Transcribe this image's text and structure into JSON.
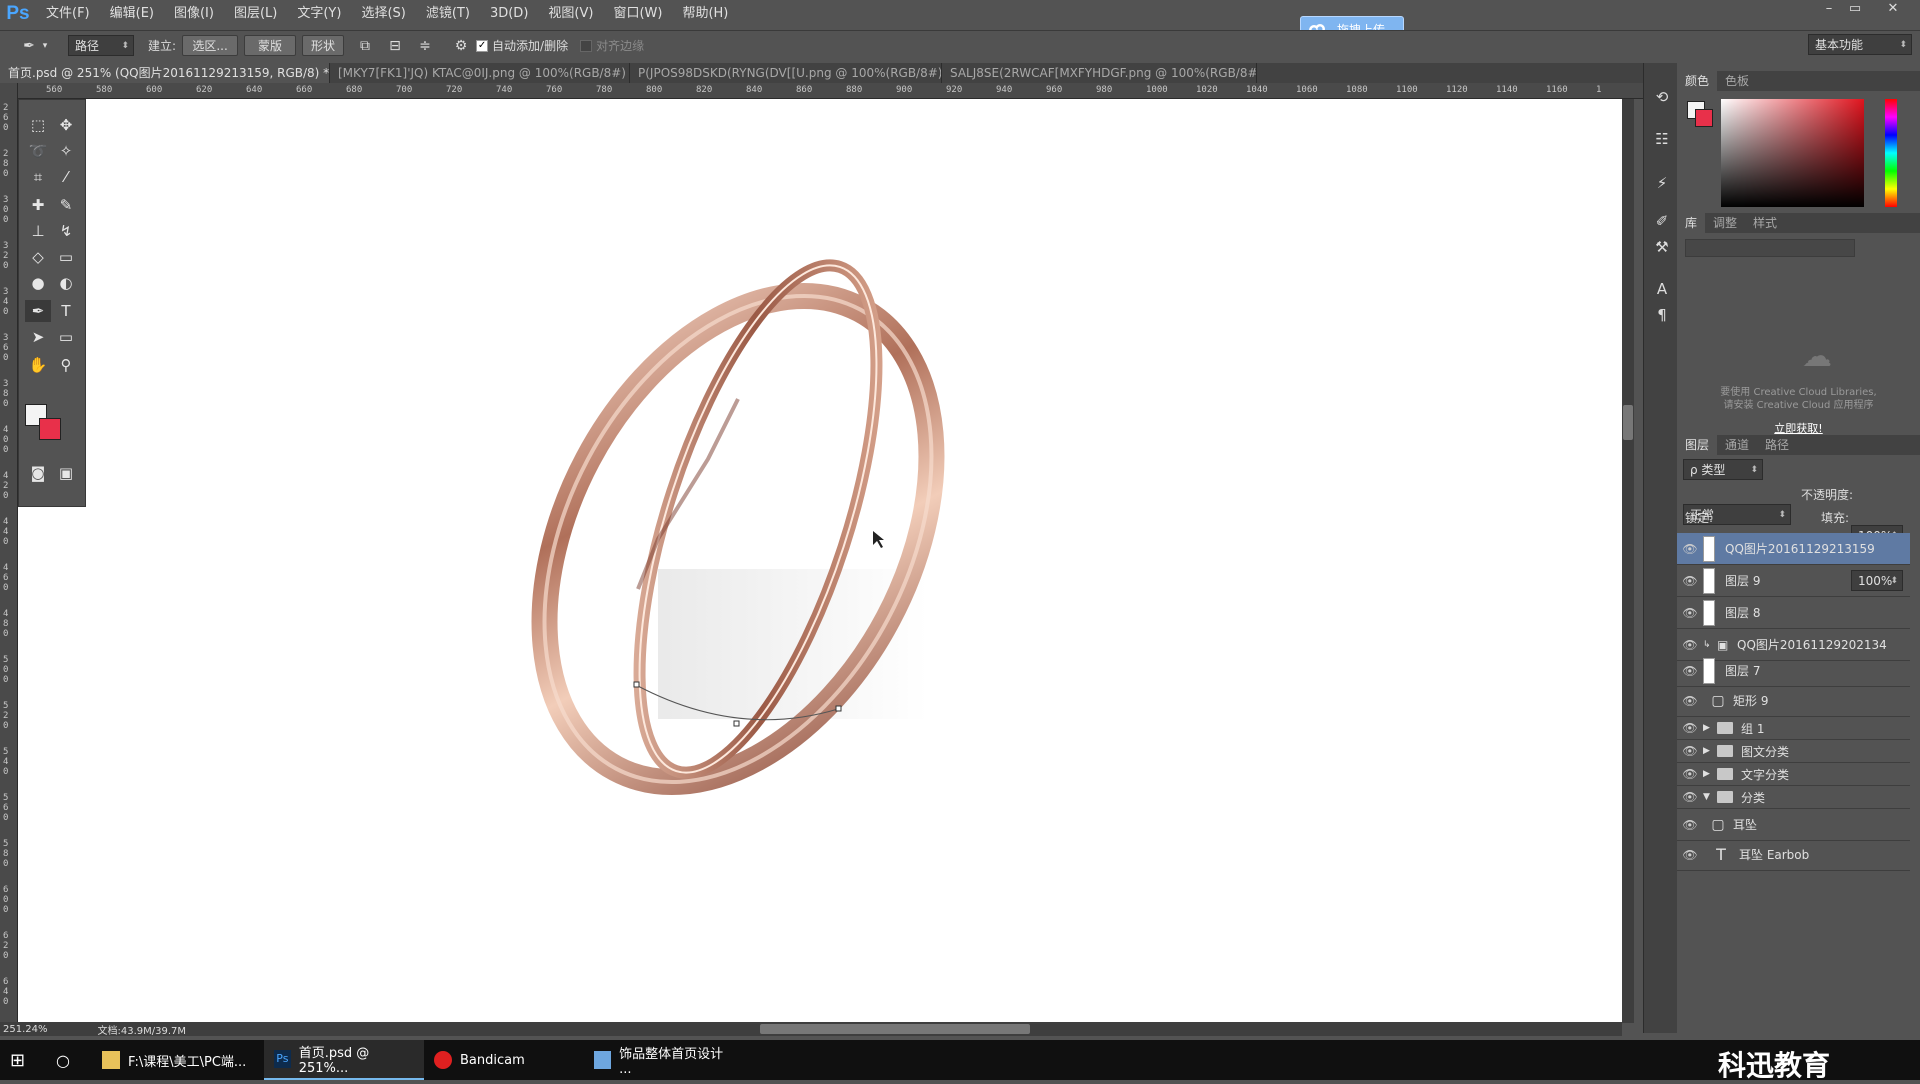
{
  "app": {
    "logo": "Ps"
  },
  "menubar": {
    "items": [
      "文件(F)",
      "编辑(E)",
      "图像(I)",
      "图层(L)",
      "文字(Y)",
      "选择(S)",
      "滤镜(T)",
      "3D(D)",
      "视图(V)",
      "窗口(W)",
      "帮助(H)"
    ],
    "cloud_upload": "拖拽上传",
    "window_buttons": [
      "–",
      "▭",
      "✕"
    ]
  },
  "options_bar": {
    "tool_icon": "pen-icon",
    "mode_select": "路径",
    "make_label": "建立:",
    "selection_button": "选区...",
    "mask_button": "蒙版",
    "shape_button": "形状",
    "auto_add_delete_label": "自动添加/删除",
    "auto_add_delete_checked": true,
    "align_edges_label": "对齐边缘",
    "align_edges_checked": false,
    "workspace_select": "基本功能"
  },
  "tabs": [
    {
      "label": "首页.psd @ 251% (QQ图片20161129213159, RGB/8) *",
      "active": true
    },
    {
      "label": "[MKY7[FK1]'JQ) KTAC@0IJ.png @ 100%(RGB/8#)",
      "active": false
    },
    {
      "label": "P(JPOS98DSKD(RYNG(DV[[U.png @ 100%(RGB/8#)",
      "active": false
    },
    {
      "label": "SALJ8SE(2RWCAF[MXFYHDGF.png @ 100%(RGB/8#)",
      "active": false
    }
  ],
  "ruler": {
    "h_ticks": [
      "560",
      "580",
      "600",
      "620",
      "640",
      "660",
      "680",
      "700",
      "720",
      "740",
      "760",
      "780",
      "800",
      "820",
      "840",
      "860",
      "880",
      "900",
      "920",
      "940",
      "960",
      "980",
      "1000",
      "1020",
      "1040",
      "1060",
      "1080",
      "1100",
      "1120",
      "1140",
      "1160",
      "1"
    ],
    "v_ticks": [
      "260",
      "280",
      "300",
      "320",
      "340",
      "360",
      "380",
      "400",
      "420",
      "440",
      "460",
      "480",
      "500",
      "520",
      "540",
      "560",
      "580",
      "600",
      "620",
      "640"
    ]
  },
  "status": {
    "zoom": "251.24%",
    "doc": "文档:43.9M/39.7M"
  },
  "color_panel": {
    "tabs": [
      "颜色",
      "色板"
    ],
    "fg": "#f4f4f4",
    "bg": "#e8304a"
  },
  "library_panel": {
    "tabs": [
      "库",
      "调整",
      "样式"
    ],
    "message_line1": "要使用 Creative Cloud Libraries,",
    "message_line2": "请安装 Creative Cloud 应用程序",
    "get_link": "立即获取!"
  },
  "layers_panel": {
    "tabs": [
      "图层",
      "通道",
      "路径"
    ],
    "filter_select": "ρ 类型",
    "blend_mode": "正常",
    "opacity_label": "不透明度:",
    "opacity_value": "100%",
    "lock_label": "锁定:",
    "fill_label": "填充:",
    "fill_value": "100%",
    "layers": [
      {
        "name": "QQ图片20161129213159",
        "selected": true,
        "kind": "image"
      },
      {
        "name": "图层 9",
        "selected": false,
        "kind": "image"
      },
      {
        "name": "图层 8",
        "selected": false,
        "kind": "image"
      },
      {
        "name": "QQ图片20161129202134",
        "selected": false,
        "kind": "smart"
      },
      {
        "name": "图层 7",
        "selected": false,
        "kind": "image"
      },
      {
        "name": "矩形 9",
        "selected": false,
        "kind": "shape"
      },
      {
        "name": "组 1",
        "selected": false,
        "kind": "group"
      },
      {
        "name": "图文分类",
        "selected": false,
        "kind": "group"
      },
      {
        "name": "文字分类",
        "selected": false,
        "kind": "group"
      },
      {
        "name": "分类",
        "selected": false,
        "kind": "group-open"
      },
      {
        "name": "耳坠",
        "selected": false,
        "kind": "shape"
      },
      {
        "name": "耳坠 Earbob",
        "selected": false,
        "kind": "text"
      }
    ]
  },
  "taskbar": {
    "items": [
      {
        "label": "F:\\课程\\美工\\PC端...",
        "icon": "folder-icon"
      },
      {
        "label": "首页.psd @ 251%...",
        "icon": "photoshop-icon",
        "active": true
      },
      {
        "label": "Bandicam",
        "icon": "bandicam-icon"
      },
      {
        "label": "饰品整体首页设计 ...",
        "icon": "image-viewer-icon"
      }
    ],
    "brand": "科迅教育"
  }
}
